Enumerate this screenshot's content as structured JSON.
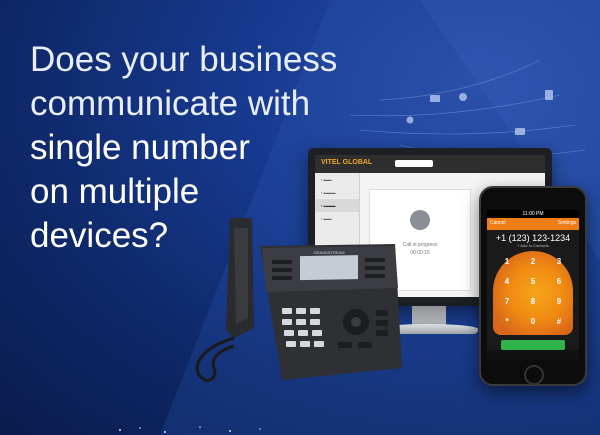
{
  "headline": {
    "line1": "Does your business",
    "line2": "communicate with",
    "line3": "single number",
    "line4": "on multiple",
    "line5": "devices?"
  },
  "monitor_app": {
    "logo_text": "VITEL GLOBAL",
    "call_status": "Call in progress",
    "call_timer": "00:00:15"
  },
  "mobile_app": {
    "status_time": "11:00 PM",
    "cancel_label": "Cancel",
    "settings_label": "Settings",
    "dialed_number": "+1 (123) 123-1234",
    "add_contact": "+ Add to Contacts"
  },
  "deskphone": {
    "brand": "GRANDSTREAM"
  },
  "colors": {
    "bg_dark": "#0e2766",
    "bg_accent": "#2a4ea8",
    "mobile_accent": "#f07c16",
    "call_green": "#2fb34a"
  }
}
